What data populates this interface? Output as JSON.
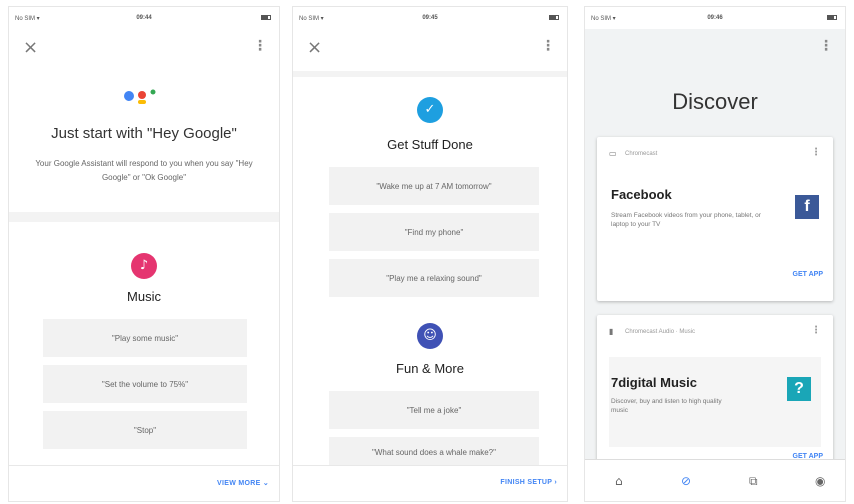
{
  "status": {
    "carrier": "No SIM ▾",
    "times": [
      "09:44",
      "09:45",
      "09:46"
    ]
  },
  "panel1": {
    "title": "Just start with \"Hey Google\"",
    "subtitle": "Your Google Assistant will respond to you when you say \"Hey Google\" or \"Ok Google\"",
    "category": "Music",
    "category_icon": "music-note-icon",
    "chips": [
      "\"Play some music\"",
      "\"Set the volume to 75%\"",
      "\"Stop\""
    ],
    "footer_link": "VIEW MORE ⌄",
    "close_icon": "close-icon",
    "kebab_icon": "more-vert-icon"
  },
  "panel2": {
    "section1_title": "Get Stuff Done",
    "section1_chips": [
      "\"Wake me up at 7 AM tomorrow\"",
      "\"Find my phone\"",
      "\"Play me a relaxing sound\""
    ],
    "section2_title": "Fun & More",
    "section2_chips": [
      "\"Tell me a joke\"",
      "\"What sound does a whale make?\""
    ],
    "footer_link": "FINISH SETUP ›"
  },
  "panel3": {
    "title": "Discover",
    "cards": [
      {
        "type_label": "Chromecast",
        "title": "Facebook",
        "description": "Stream Facebook videos from your phone, tablet, or laptop to your TV",
        "app_glyph": "f",
        "action": "GET APP",
        "app_color": "#3b5998"
      },
      {
        "type_label": "Chromecast Audio · Music",
        "title": "7digital Music",
        "description": "Discover, buy and listen to high quality music",
        "app_glyph": "?",
        "action": "GET APP",
        "app_color": "#1aa6b7"
      }
    ],
    "nav": [
      "home-icon",
      "explore-icon",
      "updates-icon",
      "account-icon"
    ]
  },
  "colors": {
    "accent": "#4285f4",
    "music": "#e53570",
    "get_stuff_done": "#1e9fe0",
    "fun_more": "#3f51b5"
  }
}
